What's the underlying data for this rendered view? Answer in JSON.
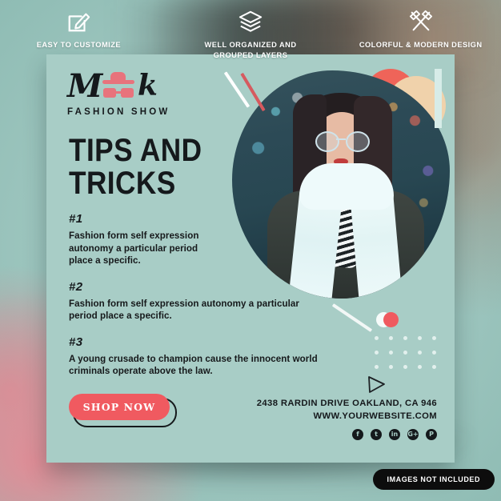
{
  "features": [
    {
      "icon": "pencil-square-icon",
      "label": "EASY TO CUSTOMIZE"
    },
    {
      "icon": "layers-icon",
      "label": "WELL ORGANIZED AND\nGROUPED LAYERS"
    },
    {
      "icon": "pencil-ruler-icon",
      "label": "COLORFUL & MODERN DESIGN"
    }
  ],
  "brand": {
    "mark_left": "M",
    "mark_right": "k",
    "tagline": "FASHION SHOW",
    "hat_icon": "fedora-hat-icon",
    "glasses_icon": "sunglasses-icon"
  },
  "headline": {
    "line1": "TIPS AND",
    "line2": "TRICKS"
  },
  "tips": [
    {
      "number": "#1",
      "text": "Fashion form self expression autonomy a particular period place a specific."
    },
    {
      "number": "#2",
      "text": "Fashion form self expression autonomy a particular period place a specific."
    },
    {
      "number": "#3",
      "text": "A young crusade to champion cause the innocent world criminals operate above the law."
    }
  ],
  "cta": {
    "label": "SHOP NOW"
  },
  "contact": {
    "address": "2438 RARDIN DRIVE OAKLAND, CA 946",
    "website": "WWW.YOURWEBSITE.COM",
    "socials": [
      {
        "name": "facebook-icon",
        "glyph": "f"
      },
      {
        "name": "twitter-icon",
        "glyph": "t"
      },
      {
        "name": "linkedin-icon",
        "glyph": "in"
      },
      {
        "name": "google-plus-icon",
        "glyph": "G+"
      },
      {
        "name": "pinterest-icon",
        "glyph": "P"
      }
    ]
  },
  "badge": {
    "label": "IMAGES NOT INCLUDED"
  },
  "colors": {
    "card_background": "#a8cdc6",
    "accent_coral": "#f05a60",
    "ink": "#15191c",
    "tan_circle": "#f0d2ab",
    "coral_circle": "#ef6459",
    "light_bar": "#d7ece8",
    "badge_background": "#0d0d0d"
  }
}
